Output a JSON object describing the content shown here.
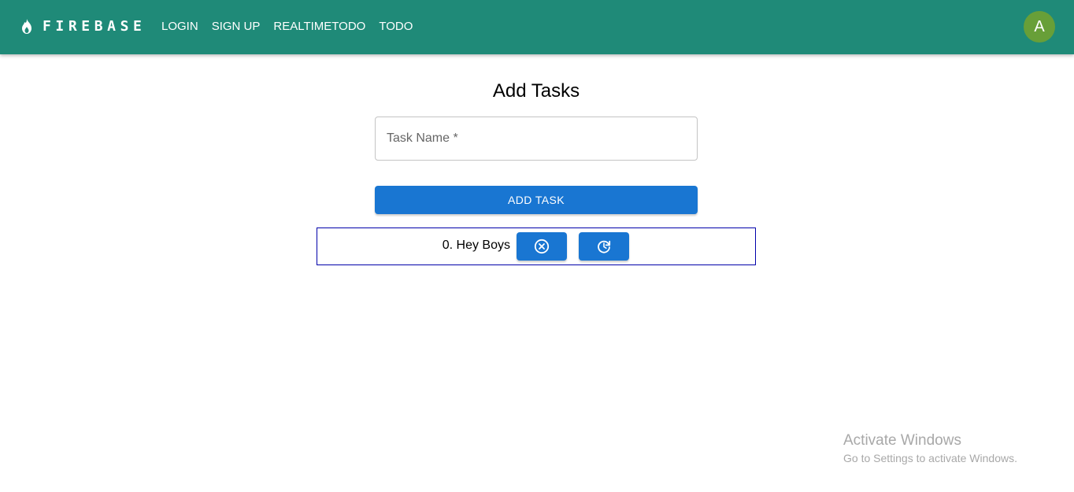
{
  "appbar": {
    "brand": "FIREBASE",
    "brand_icon": "flame-icon",
    "color": "#1f8a78",
    "nav": [
      {
        "label": "LOGIN"
      },
      {
        "label": "SIGN UP"
      },
      {
        "label": "REALTIMETODO"
      },
      {
        "label": "TODO"
      }
    ],
    "avatar": {
      "letter": "A",
      "color": "#689f38"
    }
  },
  "main": {
    "title": "Add Tasks",
    "task_field": {
      "label": "Task Name *",
      "value": ""
    },
    "add_button": "ADD TASK",
    "accent": "#1976d2"
  },
  "tasks": [
    {
      "index": "0.",
      "text": "Hey Boys",
      "actions": [
        {
          "icon": "cancel-circle-icon"
        },
        {
          "icon": "update-clock-icon"
        }
      ]
    }
  ],
  "watermark": {
    "title": "Activate Windows",
    "subtitle": "Go to Settings to activate Windows."
  }
}
